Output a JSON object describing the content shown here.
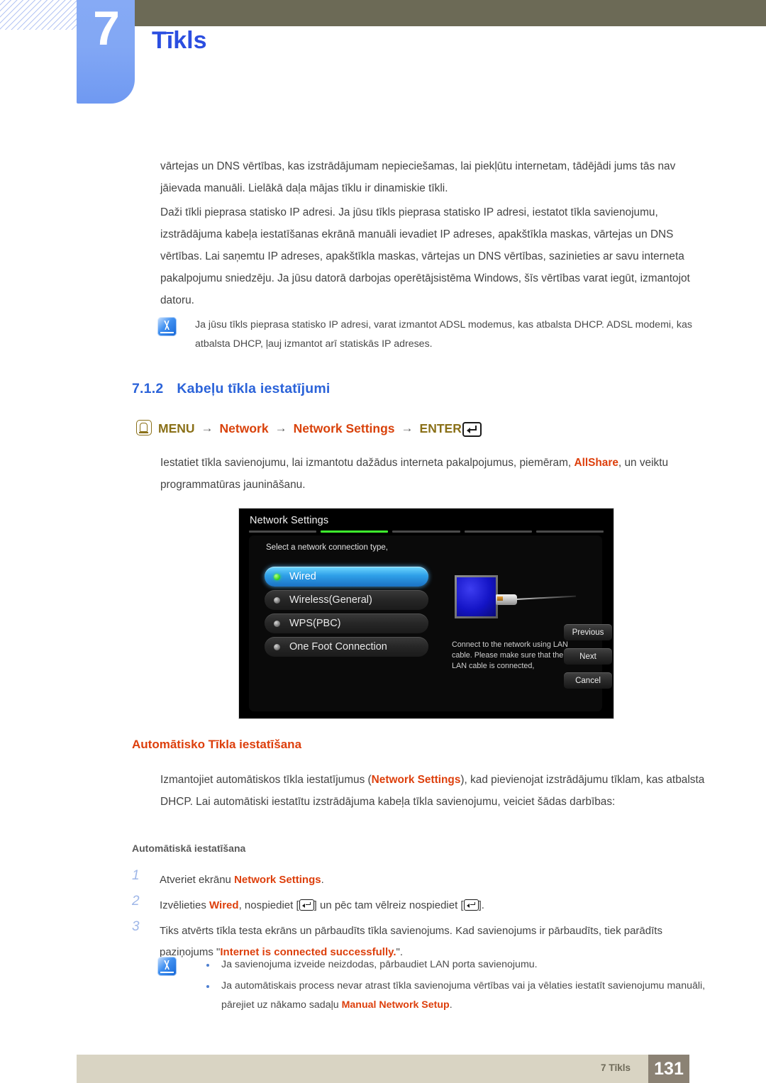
{
  "chapter": {
    "number": "7",
    "title": "Tīkls"
  },
  "paragraphs": {
    "p1": "vārtejas un DNS vērtības, kas izstrādājumam nepieciešamas, lai piekļūtu internetam, tādējādi jums tās nav jāievada manuāli. Lielākā daļa mājas tīklu ir dinamiskie tīkli.",
    "p2": "Daži tīkli pieprasa statisko IP adresi. Ja jūsu tīkls pieprasa statisko IP adresi, iestatot tīkla savienojumu, izstrādājuma kabeļa iestatīšanas ekrānā manuāli ievadiet IP adreses, apakštīkla maskas, vārtejas un DNS vērtības. Lai saņemtu IP adreses, apakštīkla maskas, vārtejas un DNS vērtības, sazinieties ar savu interneta pakalpojumu sniedzēju. Ja jūsu datorā darbojas operētājsistēma Windows, šīs vērtības varat iegūt, izmantojot datoru."
  },
  "note_top": {
    "icon": "note-pen-icon",
    "text": "Ja jūsu tīkls pieprasa statisko IP adresi, varat izmantot ADSL modemus, kas atbalsta DHCP. ADSL modemi, kas atbalsta DHCP, ļauj izmantot arī statiskās IP adreses."
  },
  "section": {
    "number": "7.1.2",
    "title": "Kabeļu tīkla iestatījumi"
  },
  "menu_path": {
    "menu_icon": "menu-button-icon",
    "menu": "MENU",
    "arrow": "→",
    "step1": "Network",
    "step2": "Network Settings",
    "enter": "ENTER",
    "enter_icon": "enter-key-icon"
  },
  "intro": {
    "before": "Iestatiet tīkla savienojumu, lai izmantotu dažādus interneta pakalpojumus, piemēram, ",
    "highlight": "AllShare",
    "after": ", un veiktu programmatūras jaunināšanu."
  },
  "tv_screen": {
    "title": "Network Settings",
    "prompt": "Select a network connection type,",
    "tab_count": 5,
    "active_tab_index": 1,
    "options": [
      {
        "label": "Wired",
        "selected": true
      },
      {
        "label": "Wireless(General)",
        "selected": false
      },
      {
        "label": "WPS(PBC)",
        "selected": false
      },
      {
        "label": "One Foot Connection",
        "selected": false
      }
    ],
    "description": "Connect to the network using LAN cable. Please make sure that the LAN cable is connected,",
    "buttons": [
      "Previous",
      "Next",
      "Cancel"
    ],
    "colors": {
      "selected_accent": "#2e9fe8",
      "active_tab": "#3ef42e",
      "port": "#1414c6"
    }
  },
  "auto_section": {
    "heading": "Automātisko Tīkla iestatīšana",
    "body_before": "Izmantojiet automātiskos tīkla iestatījumus (",
    "body_highlight": "Network Settings",
    "body_after": "), kad pievienojat izstrādājumu tīklam, kas atbalsta DHCP. Lai automātiski iestatītu izstrādājuma kabeļa tīkla savienojumu, veiciet šādas darbības:",
    "subheading": "Automātiskā iestatīšana"
  },
  "steps": [
    {
      "num": "1",
      "before": "Atveriet ekrānu ",
      "highlight": "Network Settings",
      "after": "."
    },
    {
      "num": "2",
      "before": "Izvēlieties ",
      "highlight": "Wired",
      "mid1": ", nospiediet [",
      "mid2": "] un pēc tam vēlreiz nospiediet [",
      "after": "]."
    },
    {
      "num": "3",
      "before": "Tiks atvērts tīkla testa ekrāns un pārbaudīts tīkla savienojums. Kad savienojums ir pārbaudīts, tiek parādīts paziņojums \"",
      "highlight": "Internet is connected successfully.",
      "after": "\"."
    }
  ],
  "note_bottom": {
    "icon": "note-pen-icon",
    "items": [
      {
        "text": "Ja savienojuma izveide neizdodas, pārbaudiet LAN porta savienojumu."
      },
      {
        "before": "Ja automātiskais process nevar atrast tīkla savienojuma vērtības vai ja vēlaties iestatīt savienojumu manuāli, pārejiet uz nākamo sadaļu ",
        "highlight": "Manual Network Setup",
        "after": "."
      }
    ]
  },
  "footer": {
    "label": "7 Tīkls",
    "page": "131"
  },
  "colors": {
    "chapter_tab": "#82a7f4",
    "olive_bar": "#6c6a56",
    "heading_blue": "#2b63d9",
    "accent_red": "#dd3f0c",
    "menu_gold": "#8a7018",
    "footer_bar": "#d9d4c3",
    "footer_page": "#8b8274"
  }
}
